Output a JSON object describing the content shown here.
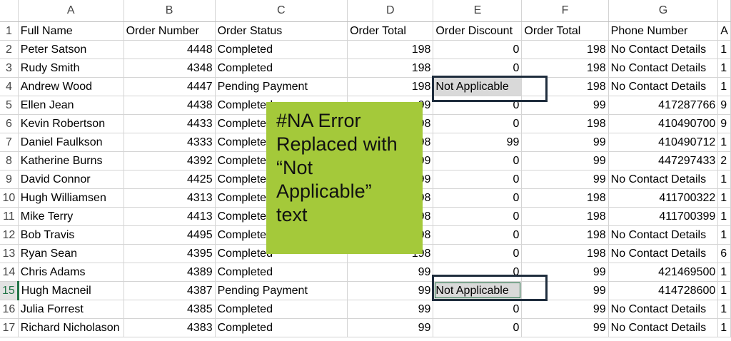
{
  "columns": [
    "",
    "A",
    "B",
    "C",
    "D",
    "E",
    "F",
    "G",
    ""
  ],
  "row_numbers": [
    "1",
    "2",
    "3",
    "4",
    "5",
    "6",
    "7",
    "8",
    "9",
    "10",
    "11",
    "12",
    "13",
    "14",
    "15",
    "16",
    "17"
  ],
  "header_row": [
    "Full Name",
    "Order Number",
    "Order Status",
    "Order Total",
    "Order Discount",
    "Order Total",
    "Phone Number",
    "A"
  ],
  "rows": [
    [
      "Peter Satson",
      "4448",
      "Completed",
      "198",
      "0",
      "198",
      "No Contact Details",
      "1"
    ],
    [
      "Rudy Smith",
      "4348",
      "Completed",
      "198",
      "0",
      "198",
      "No Contact Details",
      "1"
    ],
    [
      "Andrew Wood",
      "4447",
      "Pending Payment",
      "198",
      "Not Applicable",
      "198",
      "No Contact Details",
      "1"
    ],
    [
      "Ellen Jean",
      "4438",
      "Completed",
      "99",
      "0",
      "99",
      "417287766",
      "9"
    ],
    [
      "Kevin Robertson",
      "4433",
      "Completed",
      "198",
      "0",
      "198",
      "410490700",
      "9"
    ],
    [
      "Daniel Faulkson",
      "4333",
      "Completed",
      "198",
      "99",
      "99",
      "410490712",
      "1"
    ],
    [
      "Katherine Burns",
      "4392",
      "Completed",
      "99",
      "0",
      "99",
      "447297433",
      "2"
    ],
    [
      "David Connor",
      "4425",
      "Completed",
      "99",
      "0",
      "99",
      "No Contact Details",
      "1"
    ],
    [
      "Hugh Williamsen",
      "4313",
      "Completed",
      "198",
      "0",
      "198",
      "411700322",
      "1"
    ],
    [
      "Mike Terry",
      "4413",
      "Completed",
      "198",
      "0",
      "198",
      "411700399",
      "1"
    ],
    [
      "Bob Travis",
      "4495",
      "Completed",
      "198",
      "0",
      "198",
      "No Contact Details",
      "1"
    ],
    [
      "Ryan Sean",
      "4395",
      "Completed",
      "198",
      "0",
      "198",
      "No Contact Details",
      "6"
    ],
    [
      "Chris Adams",
      "4389",
      "Completed",
      "99",
      "0",
      "99",
      "421469500",
      "1"
    ],
    [
      "Hugh Macneil",
      "4387",
      "Pending Payment",
      "99",
      "Not Applicable",
      "99",
      "414728600",
      "1"
    ],
    [
      "Julia Forrest",
      "4385",
      "Completed",
      "99",
      "0",
      "99",
      "No Contact Details",
      "1"
    ],
    [
      "Richard Nicholason",
      "4383",
      "Completed",
      "99",
      "0",
      "99",
      "No Contact Details",
      "1"
    ]
  ],
  "note_lines": [
    "#NA Error",
    "Replaced with",
    "“Not",
    "Applicable”",
    "text"
  ],
  "colors": {
    "note_bg": "#a4c93a",
    "callout_border": "#1f2d3d",
    "active_header": "#217346"
  }
}
